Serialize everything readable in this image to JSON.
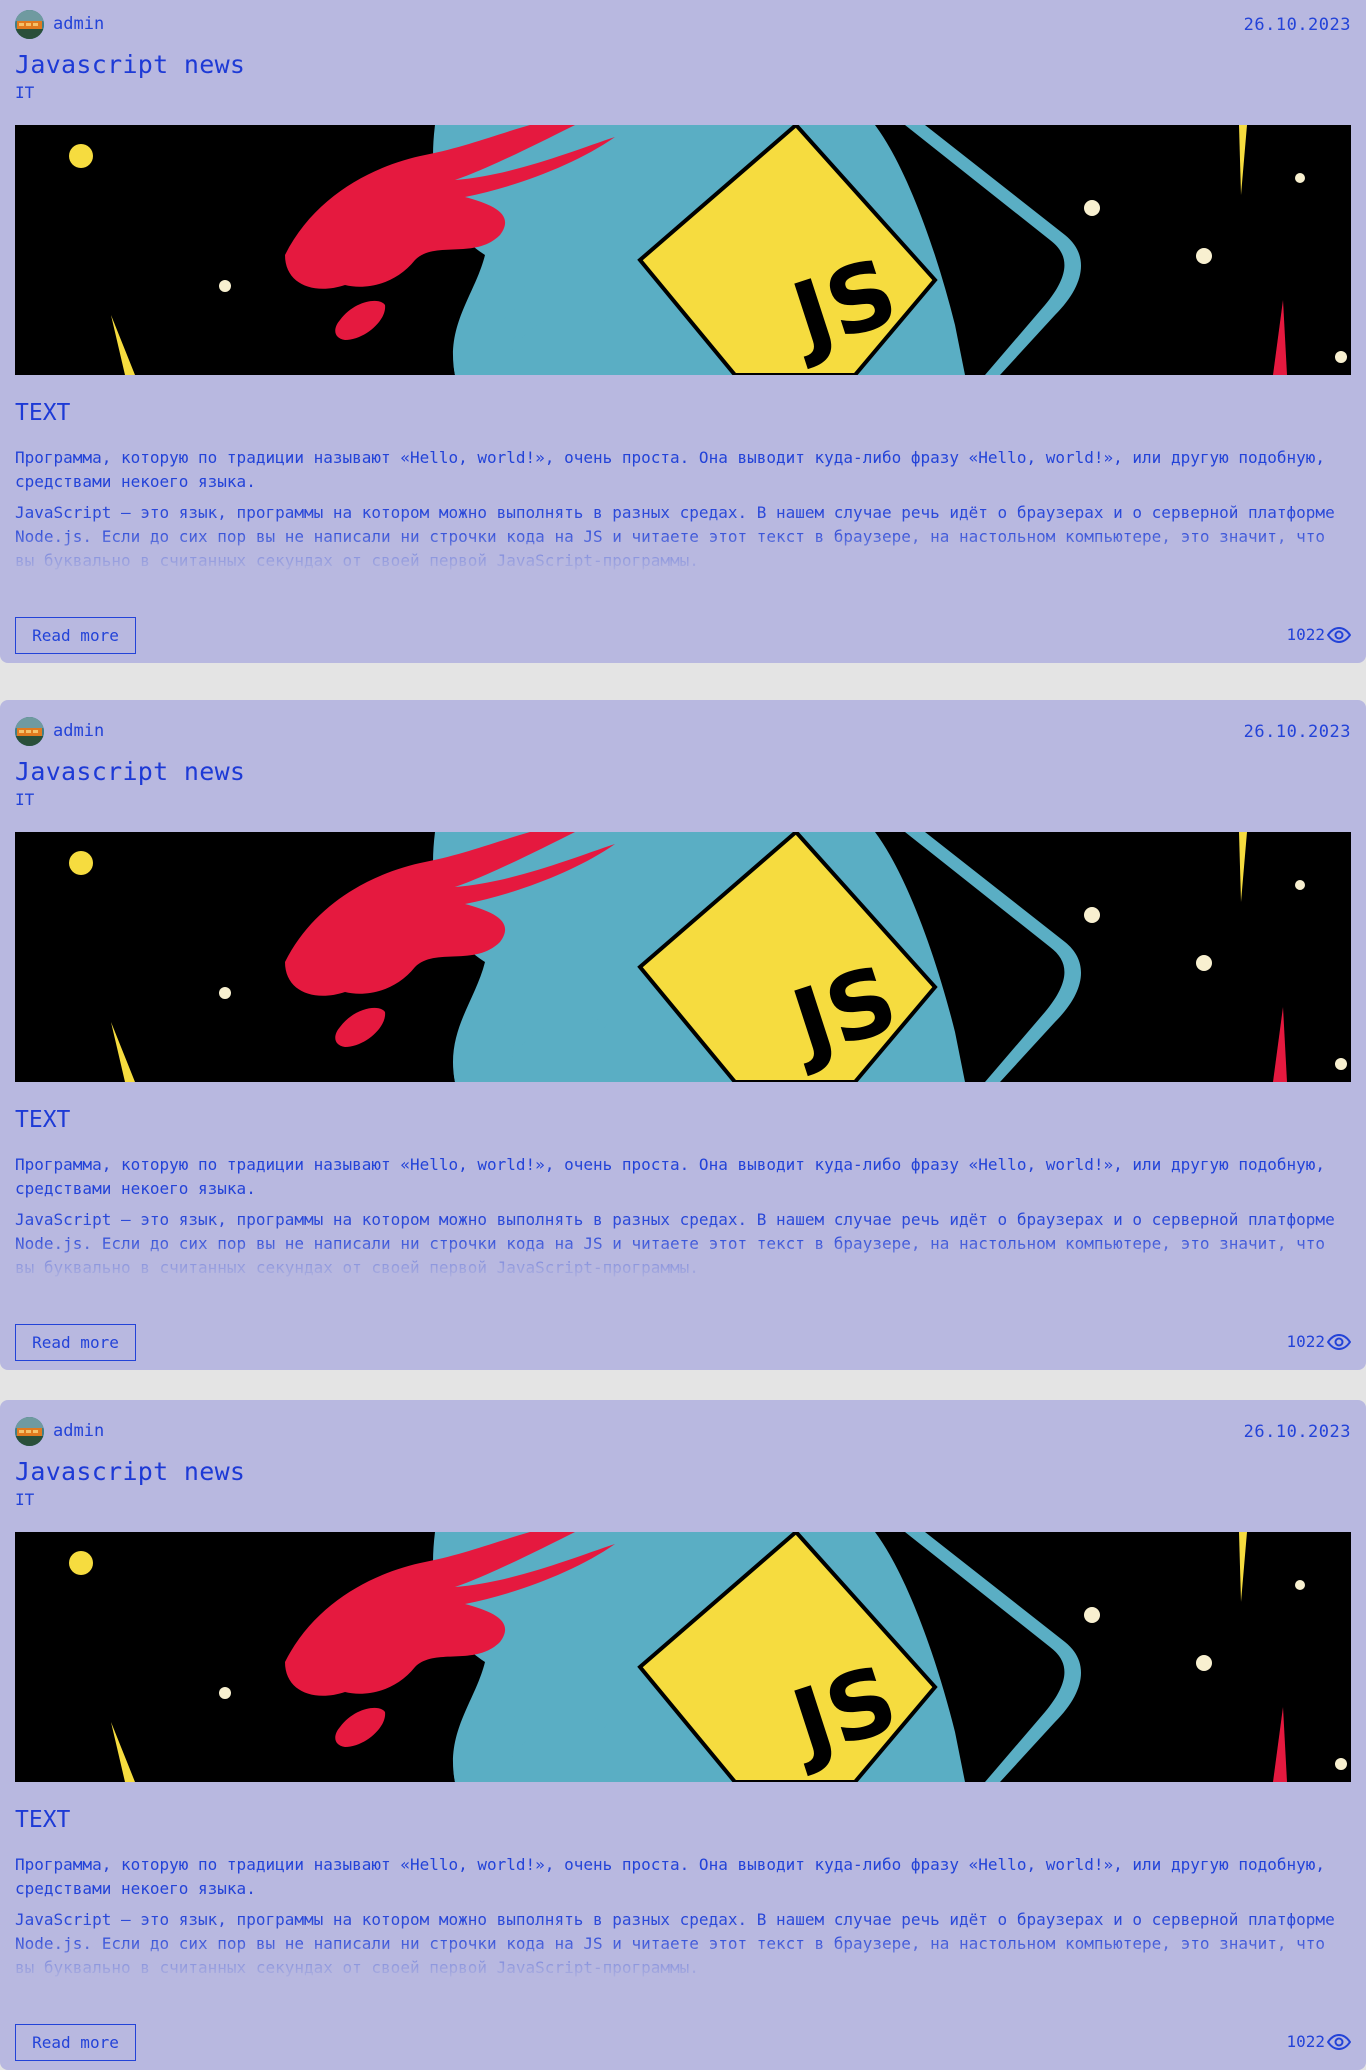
{
  "colors": {
    "page_bg": "#e4e4e4",
    "card_bg": "#b8b8e0",
    "accent_text": "#2343d8",
    "banner_bg": "#000000",
    "banner_blue": "#5aaec4",
    "banner_yellow": "#f6dc3f",
    "banner_red": "#e5193f"
  },
  "posts": [
    {
      "author": "admin",
      "date": "26.10.2023",
      "title": "Javascript news",
      "category": "IT",
      "image_icon": "javascript-banner-image",
      "subtitle": "TEXT",
      "intro": "Программа, которую по традиции называют «Hello, world!», очень проста. Она выводит куда-либо фразу «Hello, world!», или другую подобную, средствами некоего языка.",
      "excerpt": "JavaScript — это язык, программы на котором можно выполнять в разных средах. В нашем случае речь идёт о браузерах и о серверной платформе Node.js. Если до сих пор вы не написали ни строчки кода на JS и читаете этот текст в браузере, на настольном компьютере, это значит, что вы буквально в считанных секундах от своей первой JavaScript-программы.",
      "read_more": "Read more",
      "views": "1022",
      "views_icon": "eye-icon"
    },
    {
      "author": "admin",
      "date": "26.10.2023",
      "title": "Javascript news",
      "category": "IT",
      "image_icon": "javascript-banner-image",
      "subtitle": "TEXT",
      "intro": "Программа, которую по традиции называют «Hello, world!», очень проста. Она выводит куда-либо фразу «Hello, world!», или другую подобную, средствами некоего языка.",
      "excerpt": "JavaScript — это язык, программы на котором можно выполнять в разных средах. В нашем случае речь идёт о браузерах и о серверной платформе Node.js. Если до сих пор вы не написали ни строчки кода на JS и читаете этот текст в браузере, на настольном компьютере, это значит, что вы буквально в считанных секундах от своей первой JavaScript-программы.",
      "read_more": "Read more",
      "views": "1022",
      "views_icon": "eye-icon"
    },
    {
      "author": "admin",
      "date": "26.10.2023",
      "title": "Javascript news",
      "category": "IT",
      "image_icon": "javascript-banner-image",
      "subtitle": "TEXT",
      "intro": "Программа, которую по традиции называют «Hello, world!», очень проста. Она выводит куда-либо фразу «Hello, world!», или другую подобную, средствами некоего языка.",
      "excerpt": "JavaScript — это язык, программы на котором можно выполнять в разных средах. В нашем случае речь идёт о браузерах и о серверной платформе Node.js. Если до сих пор вы не написали ни строчки кода на JS и читаете этот текст в браузере, на настольном компьютере, это значит, что вы буквально в считанных секундах от своей первой JavaScript-программы.",
      "read_more": "Read more",
      "views": "1022",
      "views_icon": "eye-icon"
    }
  ]
}
